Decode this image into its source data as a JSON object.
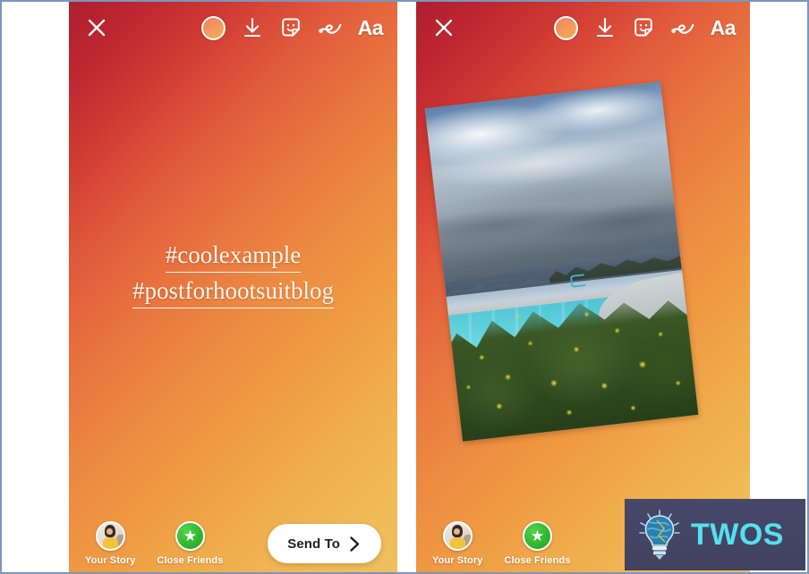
{
  "app": {
    "name": "Instagram Story Editor",
    "panel_count": 2
  },
  "colors": {
    "bg_gradient_start": "#ad1f2f",
    "bg_gradient_mid": "#ec8a41",
    "bg_gradient_end": "#eec061",
    "close_friends_green": "#31b832",
    "send_to_bg": "#ffffff",
    "send_to_text": "#1f1f1f",
    "watermark_bg": "#474869",
    "watermark_text": "#55e0ef",
    "page_border": "#7b96bd",
    "text_white": "#ffffff"
  },
  "toolbar": {
    "close_label": "Close",
    "close_icon": "close-x-icon",
    "items": [
      {
        "id": "color-picker",
        "icon": "color-circle-icon",
        "label": "Color"
      },
      {
        "id": "download",
        "icon": "download-arrow-icon",
        "label": "Save"
      },
      {
        "id": "sticker",
        "icon": "sticker-smiley-icon",
        "label": "Stickers"
      },
      {
        "id": "draw",
        "icon": "draw-squiggle-icon",
        "label": "Draw"
      },
      {
        "id": "text",
        "icon": "text-aa-icon",
        "label": "Aa"
      }
    ]
  },
  "story_text": {
    "line1": "#coolexample",
    "line2": "#postforhootsuitblog",
    "style": "serif-underlined",
    "color": "#fdf6f0"
  },
  "bottom_bar": {
    "your_story": {
      "label": "Your Story",
      "icon": "avatar"
    },
    "close_friends": {
      "label": "Close Friends",
      "icon": "green-star-badge"
    },
    "send_to": {
      "label": "Send To",
      "icon": "chevron-right-icon"
    }
  },
  "panels": [
    {
      "id": "panel-left",
      "name": "story-without-photo",
      "has_photo_sticker": false,
      "has_send_to": true,
      "text_visible": true
    },
    {
      "id": "panel-right",
      "name": "story-with-photo-sticker",
      "has_photo_sticker": true,
      "has_send_to": false,
      "text_visible": true,
      "photo": {
        "description": "Rotated photo sticker of an outdoor swimming pool with cityscape, cloudy sky, mountains and yellow flowering bushes",
        "rotation_deg": -6.5
      }
    }
  ],
  "watermark": {
    "brand": "TWOS",
    "icon": "lightbulb-icon"
  }
}
